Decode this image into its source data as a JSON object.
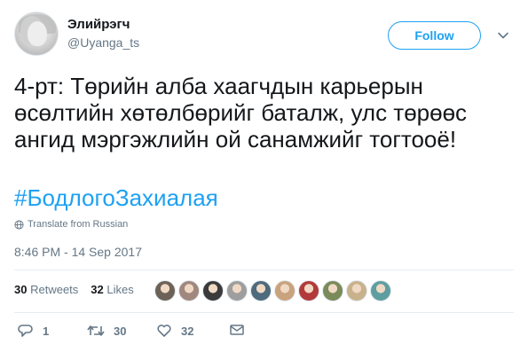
{
  "user": {
    "display_name": "Элийрэгч",
    "handle": "@Uyanga_ts",
    "avatar_icon": "profile-photo"
  },
  "follow_label": "Follow",
  "tweet": {
    "text": "4-рт: Төрийн алба хаагчдын карьерын өсөлтийн хөтөлбөрийг баталж, улс төрөөс ангид мэргэжлийн ой санамжийг тогтооё!",
    "hashtag": "#БодлогоЗахиалая",
    "translate_label": "Translate from Russian",
    "timestamp": "8:46 PM - 14 Sep 2017"
  },
  "stats": {
    "retweets_count": "30",
    "retweets_label": "Retweets",
    "likes_count": "32",
    "likes_label": "Likes"
  },
  "likers_colors": [
    "#6d6257",
    "#a1887f",
    "#3a3a3a",
    "#9e9e9e",
    "#4e6a7d",
    "#c9a27e",
    "#b23a3a",
    "#7a8a5a",
    "#c8b28c",
    "#5f9ea0"
  ],
  "actions": {
    "reply_count": "1",
    "retweet_count": "30",
    "like_count": "32"
  },
  "colors": {
    "accent": "#1da1f2",
    "muted": "#657786",
    "text": "#14171a"
  }
}
